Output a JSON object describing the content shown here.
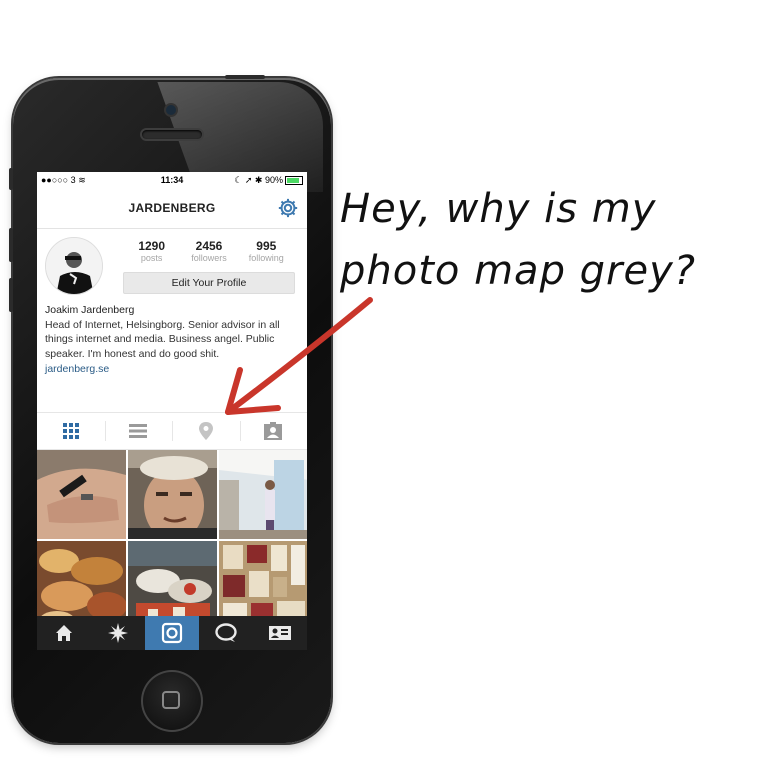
{
  "status_bar": {
    "carrier": "●●○○○ 3",
    "time": "11:34",
    "battery": "90%"
  },
  "header": {
    "title": "JARDENBERG",
    "settings_icon": "gear-icon"
  },
  "profile": {
    "stats": [
      {
        "value": "1290",
        "label": "posts"
      },
      {
        "value": "2456",
        "label": "followers"
      },
      {
        "value": "995",
        "label": "following"
      }
    ],
    "edit_label": "Edit Your Profile",
    "name": "Joakim Jardenberg",
    "bio": "Head of Internet, Helsingborg. Senior advisor in all things internet and media. Business angel. Public speaker. I'm honest and do good shit.",
    "website": "jardenberg.se"
  },
  "view_tabs": [
    {
      "icon": "grid-icon",
      "active": true
    },
    {
      "icon": "list-icon",
      "active": false
    },
    {
      "icon": "map-pin-icon",
      "active": false
    },
    {
      "icon": "tagged-person-icon",
      "active": false
    }
  ],
  "bottom_tabs": [
    {
      "icon": "home-icon"
    },
    {
      "icon": "explore-icon"
    },
    {
      "icon": "camera-icon"
    },
    {
      "icon": "activity-icon"
    },
    {
      "icon": "profile-icon"
    }
  ],
  "colors": {
    "accent": "#3f7ab0",
    "tab_bar": "#212121",
    "arrow": "#c9362b",
    "link": "#2a5b86"
  },
  "annotation": {
    "line1": "Hey, why is my",
    "line2": "photo map grey?"
  }
}
